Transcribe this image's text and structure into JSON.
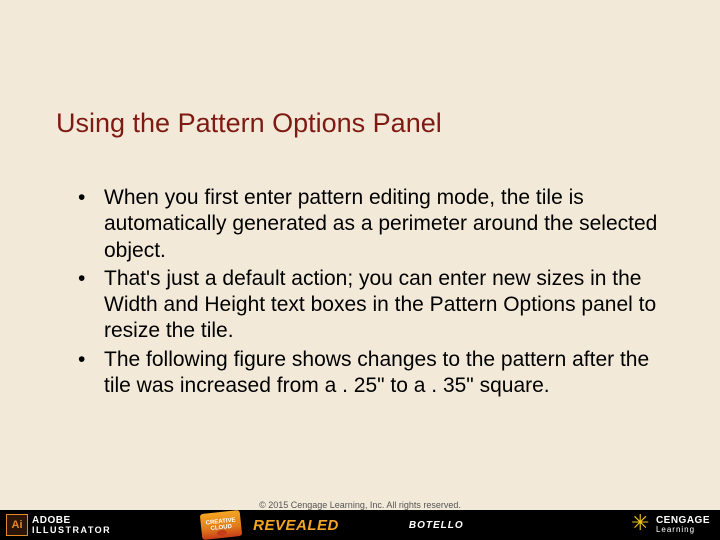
{
  "title": "Using the Pattern Options Panel",
  "bullets": [
    "When you first enter pattern editing mode, the tile is automatically generated as a perimeter around the selected object.",
    "That's just a default action; you can enter new sizes in the Width and Height text boxes in the Pattern Options panel to resize the tile.",
    "The following figure shows changes to the pattern after the tile was increased from a . 25\" to a . 35\" square."
  ],
  "copyright": "© 2015 Cengage Learning, Inc. All rights reserved.",
  "footer": {
    "ai_icon": "Ai",
    "adobe_line1": "ADOBE",
    "adobe_line2": "ILLUSTRATOR",
    "cc_line1": "CREATIVE",
    "cc_line2": "CLOUD",
    "revealed": "REVEALED",
    "author": "BOTELLO",
    "cengage_line1": "CENGAGE",
    "cengage_line2": "Learning"
  }
}
